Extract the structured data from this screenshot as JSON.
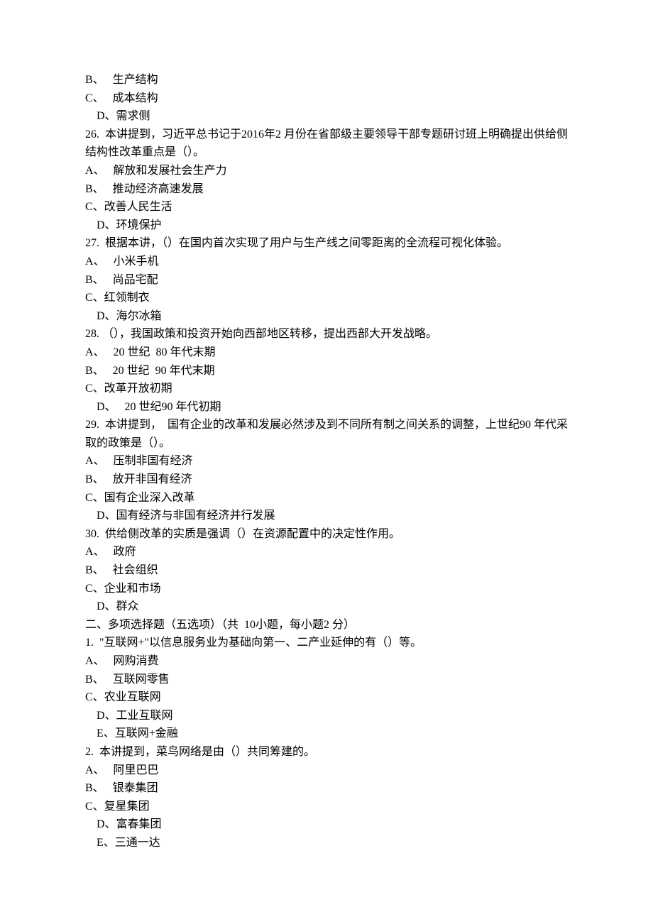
{
  "lines": [
    {
      "text": "B、   生产结构",
      "indent": 0
    },
    {
      "text": "C、   成本结构",
      "indent": 0
    },
    {
      "text": "D、需求侧",
      "indent": 1
    },
    {
      "text": "26.  本讲提到，习近平总书记于2016年2 月份在省部级主要领导干部专题研讨班上明确提出供给侧结构性改革重点是（）。",
      "indent": 0
    },
    {
      "text": "A、   解放和发展社会生产力",
      "indent": 0
    },
    {
      "text": "B、   推动经济高速发展",
      "indent": 0
    },
    {
      "text": "C、改善人民生活",
      "indent": 0
    },
    {
      "text": "D、环境保护",
      "indent": 1
    },
    {
      "text": "27.  根据本讲，（）在国内首次实现了用户与生产线之间零距离的全流程可视化体验。",
      "indent": 0
    },
    {
      "text": "A、   小米手机",
      "indent": 0
    },
    {
      "text": "B、   尚品宅配",
      "indent": 0
    },
    {
      "text": "C、红领制衣",
      "indent": 0
    },
    {
      "text": "D、海尔冰箱",
      "indent": 1
    },
    {
      "text": "28. （），我国政策和投资开始向西部地区转移，提出西部大开发战略。",
      "indent": 0
    },
    {
      "text": "A、   20 世纪  80 年代末期",
      "indent": 0
    },
    {
      "text": "B、   20 世纪  90 年代末期",
      "indent": 0
    },
    {
      "text": "C、改革开放初期",
      "indent": 0
    },
    {
      "text": "D、   20 世纪90 年代初期",
      "indent": 1
    },
    {
      "text": "29.  本讲提到，  国有企业的改革和发展必然涉及到不同所有制之间关系的调整，上世纪90 年代采取的政策是（）。",
      "indent": 0
    },
    {
      "text": "A、   压制非国有经济",
      "indent": 0
    },
    {
      "text": "B、   放开非国有经济",
      "indent": 0
    },
    {
      "text": "C、国有企业深入改革",
      "indent": 0
    },
    {
      "text": "D、国有经济与非国有经济并行发展",
      "indent": 1
    },
    {
      "text": "30.  供给侧改革的实质是强调（）在资源配置中的决定性作用。",
      "indent": 0
    },
    {
      "text": "A、   政府",
      "indent": 0
    },
    {
      "text": "B、   社会组织",
      "indent": 0
    },
    {
      "text": "C、企业和市场",
      "indent": 0
    },
    {
      "text": "D、群众",
      "indent": 1
    },
    {
      "text": "二、多项选择题（五选项）（共  10小题，每小题2 分）",
      "indent": 0
    },
    {
      "text": "1.  \"互联网+\"以信息服务业为基础向第一、二产业延伸的有（）等。",
      "indent": 0
    },
    {
      "text": "A、   网购消费",
      "indent": 0
    },
    {
      "text": "B、   互联网零售",
      "indent": 0
    },
    {
      "text": "C、农业互联网",
      "indent": 0
    },
    {
      "text": "D、工业互联网",
      "indent": 1
    },
    {
      "text": "E、互联网+金融",
      "indent": 1
    },
    {
      "text": "2.  本讲提到，菜鸟网络是由（）共同筹建的。",
      "indent": 0
    },
    {
      "text": "A、   阿里巴巴",
      "indent": 0
    },
    {
      "text": "B、   银泰集团",
      "indent": 0
    },
    {
      "text": "C、复星集团",
      "indent": 0
    },
    {
      "text": "D、富春集团",
      "indent": 1
    },
    {
      "text": "E、三通一达",
      "indent": 1
    }
  ]
}
